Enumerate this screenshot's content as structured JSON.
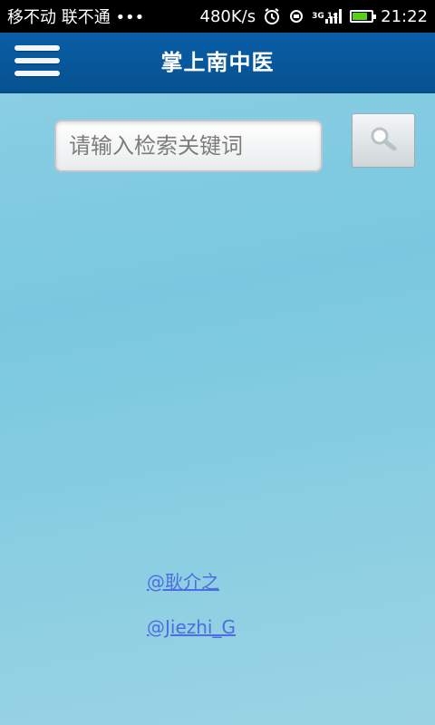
{
  "status_bar": {
    "left_text": "移不动 联不通 •••",
    "speed": "480K/s",
    "network": "3G 1x",
    "battery_level": 0.8,
    "time": "21:22",
    "icons": [
      "alarm-icon",
      "sync-icon",
      "signal-icon",
      "battery-icon"
    ]
  },
  "header": {
    "title": "掌上南中医",
    "background": "#0a5fa8"
  },
  "search": {
    "placeholder": "请输入检索关键词",
    "button_icon": "search-icon"
  },
  "footer": {
    "links": [
      "@耿介之",
      "@Jiezhi_G"
    ],
    "link_color": "#4d6de0"
  }
}
